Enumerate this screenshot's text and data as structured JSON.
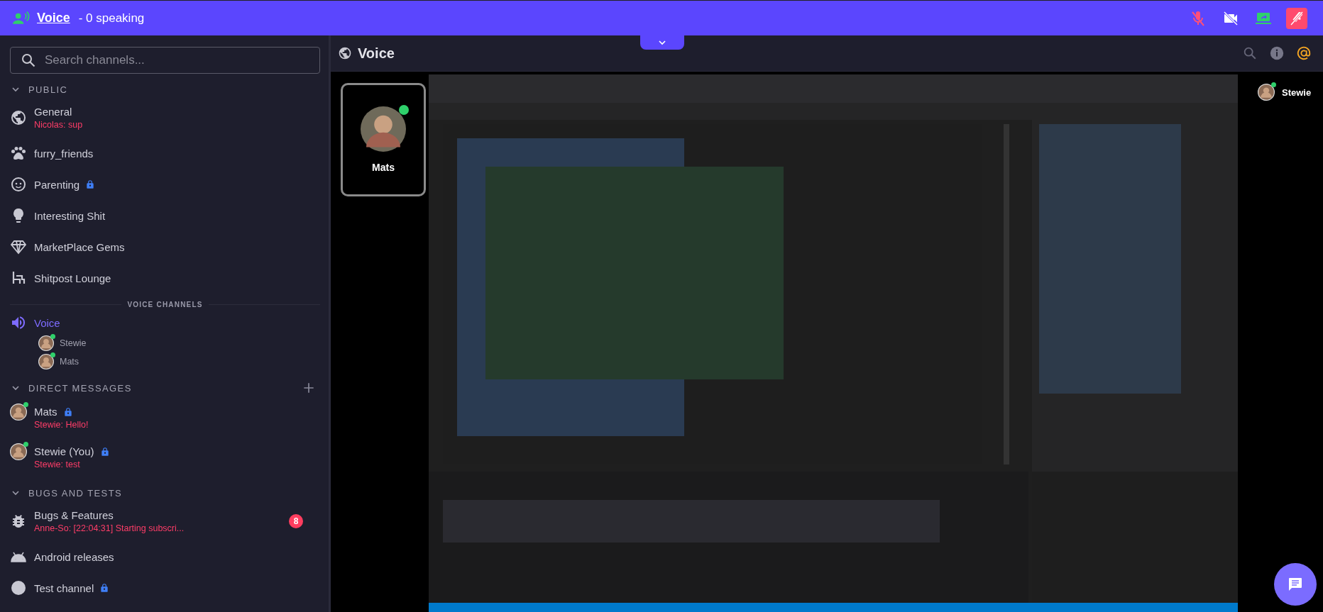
{
  "top_bar": {
    "channel": "Voice",
    "status": "- 0 speaking",
    "muted": true,
    "camera_on": false,
    "sharing_screen": true
  },
  "sidebar": {
    "search": {
      "placeholder": "Search channels..."
    },
    "sections": [
      {
        "kind": "group",
        "title": "PUBLIC",
        "expanded": true,
        "items": [
          {
            "kind": "channel",
            "name": "General",
            "last_message": "Nicolas: sup"
          },
          {
            "kind": "channel",
            "name": "furry_friends"
          },
          {
            "kind": "channel",
            "name": "Parenting",
            "locked": true
          },
          {
            "kind": "channel",
            "name": "Interesting Shit"
          },
          {
            "kind": "channel",
            "name": "MarketPlace Gems"
          },
          {
            "kind": "channel",
            "name": "Shitpost Lounge"
          }
        ]
      },
      {
        "kind": "voice",
        "title": "VOICE CHANNELS",
        "channels": [
          {
            "name": "Voice",
            "selected": true,
            "members": [
              {
                "name": "Stewie",
                "online": true
              },
              {
                "name": "Mats",
                "online": true
              }
            ]
          }
        ]
      },
      {
        "kind": "group",
        "title": "DIRECT MESSAGES",
        "expanded": true,
        "addable": true,
        "items": [
          {
            "kind": "dm",
            "name": "Mats",
            "online": true,
            "locked": true,
            "last_message": "Stewie: Hello!"
          },
          {
            "kind": "dm",
            "name": "Stewie (You)",
            "online": true,
            "locked": true,
            "last_message": "Stewie: test"
          }
        ]
      },
      {
        "kind": "group",
        "title": "BUGS AND TESTS",
        "expanded": true,
        "items": [
          {
            "kind": "channel",
            "name": "Bugs & Features",
            "last_message": "Anne-So: [22:04:31] Starting subscri...",
            "badge": "8"
          },
          {
            "kind": "channel",
            "name": "Android releases"
          },
          {
            "kind": "channel",
            "name": "Test channel",
            "locked": true
          }
        ]
      }
    ]
  },
  "main": {
    "title": "Voice",
    "tile": {
      "name": "Mats",
      "online": true
    },
    "side_participant": {
      "name": "Stewie",
      "online": true
    }
  }
}
